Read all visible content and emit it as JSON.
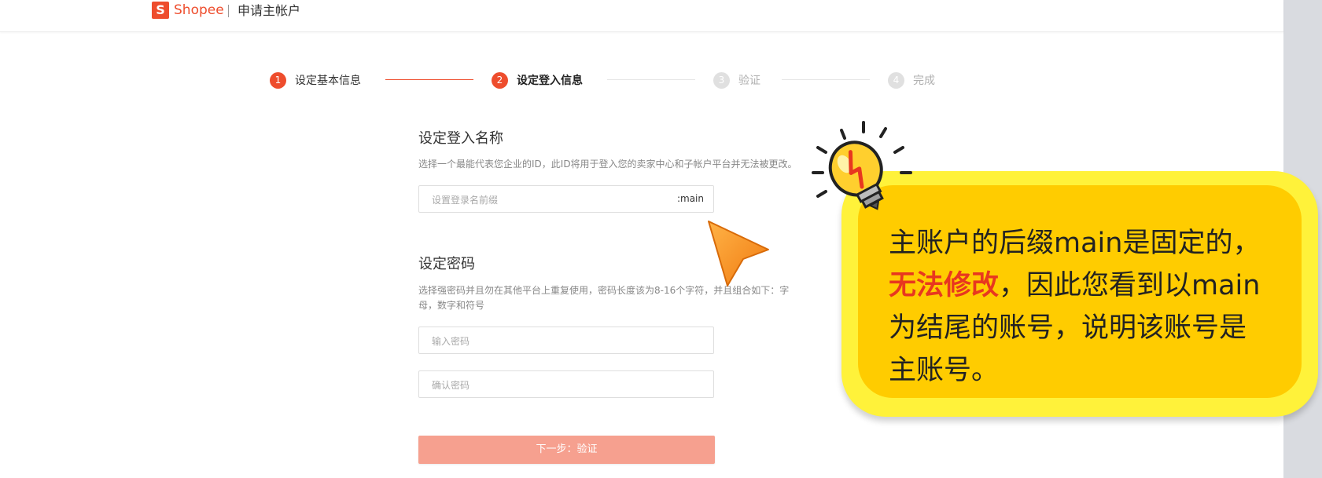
{
  "header": {
    "logo_letter": "S",
    "brand": "Shopee",
    "page_title": "申请主帐户"
  },
  "steps": [
    {
      "num": "1",
      "label": "设定基本信息",
      "state": "done"
    },
    {
      "num": "2",
      "label": "设定登入信息",
      "state": "active"
    },
    {
      "num": "3",
      "label": "验证",
      "state": "todo"
    },
    {
      "num": "4",
      "label": "完成",
      "state": "todo"
    }
  ],
  "login_section": {
    "title": "设定登入名称",
    "description": "选择一个最能代表您企业的ID，此ID将用于登入您的卖家中心和子帐户平台并无法被更改。",
    "input_placeholder": "设置登录名前缀",
    "input_suffix": ":main"
  },
  "password_section": {
    "title": "设定密码",
    "description_line1": "选择强密码并且勿在其他平台上重复使用，密码长度该为8-16个字符，并且组合如下：字",
    "description_line2": "母，数字和符号",
    "password_placeholder": "输入密码",
    "confirm_placeholder": "确认密码"
  },
  "next_button": "下一步：验证",
  "callout": {
    "line1": "主账户的后缀main是固定的，",
    "line2_emphasis": "无法修改",
    "line2_rest": "，因此您看到以main",
    "line3": "为结尾的账号，说明该账号是",
    "line4": "主账号。"
  },
  "colors": {
    "brand": "#ee4d2d",
    "button_disabled": "#f6a08f",
    "callout_fill": "#ffcc00",
    "callout_border": "#fff23a",
    "callout_emphasis": "#e8371f"
  },
  "icons": [
    "shopee-logo-icon",
    "pointer-arrow-icon",
    "lightbulb-icon"
  ]
}
